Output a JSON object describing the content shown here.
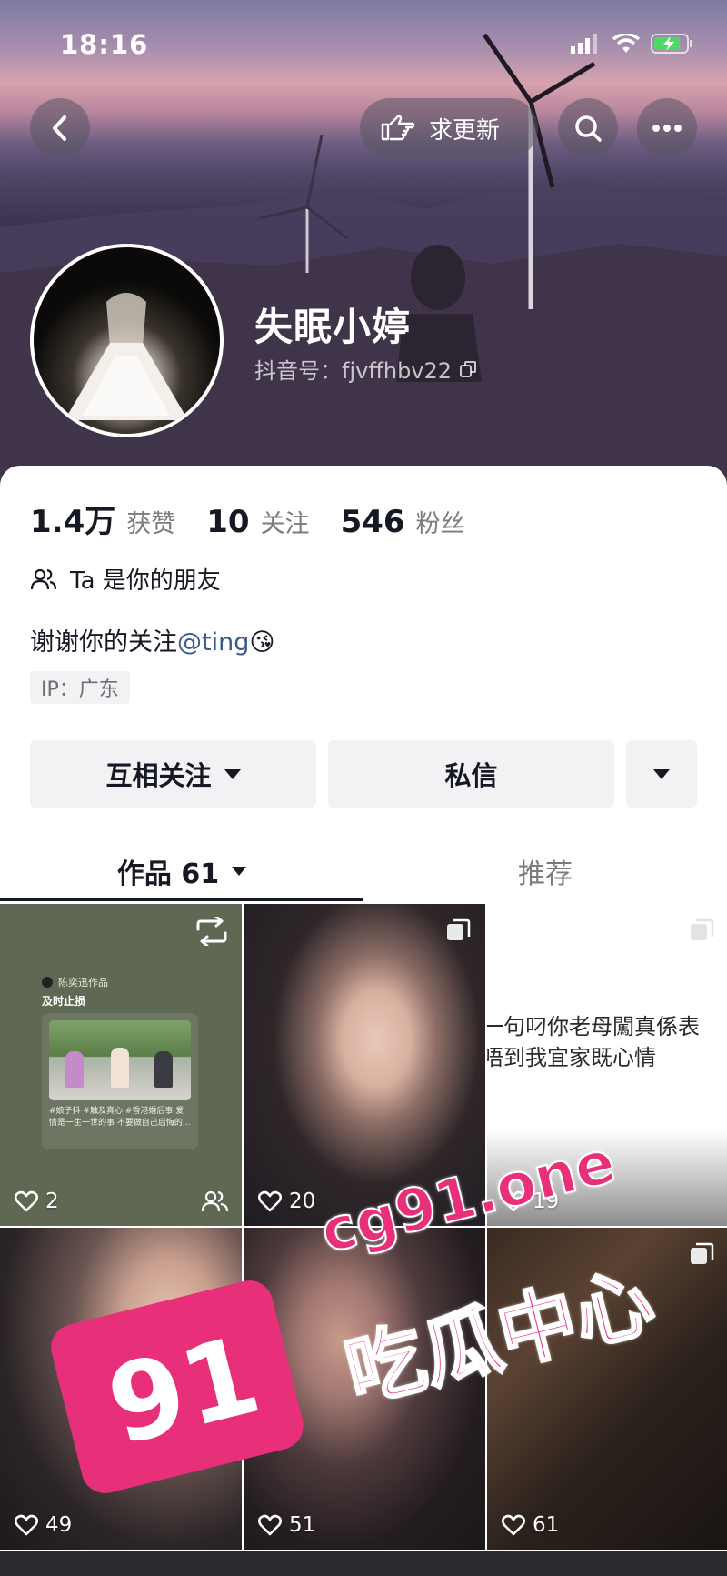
{
  "status": {
    "time": "18:16"
  },
  "header": {
    "request_update_label": "求更新"
  },
  "profile": {
    "nickname": "失眠小婷",
    "douyin_id": "抖音号：fjvffhbv22",
    "stats": [
      {
        "num": "1.4万",
        "label": "获赞"
      },
      {
        "num": "10",
        "label": "关注"
      },
      {
        "num": "546",
        "label": "粉丝"
      }
    ],
    "friend_text": "Ta 是你的朋友",
    "bio_text": "谢谢你的关注",
    "bio_mention": "@ting",
    "bio_emoji": "😘",
    "ip": "IP：广东"
  },
  "actions": {
    "mutual_follow": "互相关注",
    "message": "私信"
  },
  "tabs": {
    "works": "作品 61",
    "recommend": "推荐"
  },
  "posts": [
    {
      "likes": "2",
      "mini_title": "及时止损",
      "mini_caption": "#娘子抖 #触及真心 #香港婚后事 爱情是一生一世的事 不要做自己后悔的...",
      "mini_author": "陈奕迅作品"
    },
    {
      "likes": "20"
    },
    {
      "likes": "19",
      "text_line1": "一句叼你老母闖真係表",
      "text_line2": "唔到我宜家既心情"
    },
    {
      "likes": "49"
    },
    {
      "likes": "51"
    },
    {
      "likes": "61"
    }
  ],
  "watermark": {
    "num": "91",
    "domain": "cg91.one",
    "name": "吃瓜中心",
    "color": "#e8307a"
  }
}
